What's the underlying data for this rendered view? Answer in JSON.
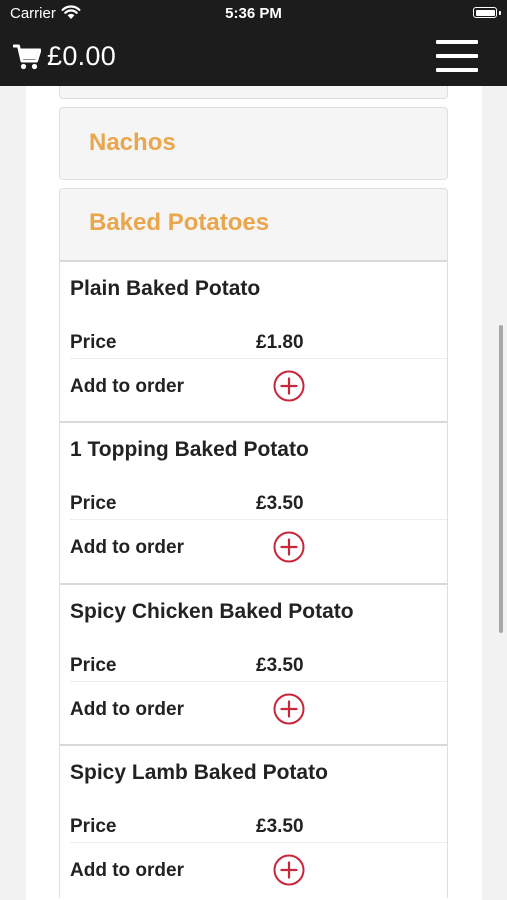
{
  "status_bar": {
    "carrier": "Carrier",
    "time": "5:36 PM"
  },
  "header": {
    "cart_total": "£0.00"
  },
  "categories": [
    {
      "title": "Nachos"
    },
    {
      "title": "Baked Potatoes"
    }
  ],
  "items": [
    {
      "name": "Plain Baked Potato",
      "price_label": "Price",
      "price": "£1.80",
      "add_label": "Add to order"
    },
    {
      "name": "1 Topping Baked Potato",
      "price_label": "Price",
      "price": "£3.50",
      "add_label": "Add to order"
    },
    {
      "name": "Spicy Chicken Baked Potato",
      "price_label": "Price",
      "price": "£3.50",
      "add_label": "Add to order"
    },
    {
      "name": "Spicy Lamb Baked Potato",
      "price_label": "Price",
      "price": "£3.50",
      "add_label": "Add to order"
    }
  ],
  "colors": {
    "category_title": "#e9a64d",
    "add_icon": "#c8263a",
    "header_bg": "#1c1c1c"
  },
  "icons": {
    "cart": "cart-icon",
    "menu": "hamburger-menu-icon",
    "add": "plus-circle-icon"
  }
}
